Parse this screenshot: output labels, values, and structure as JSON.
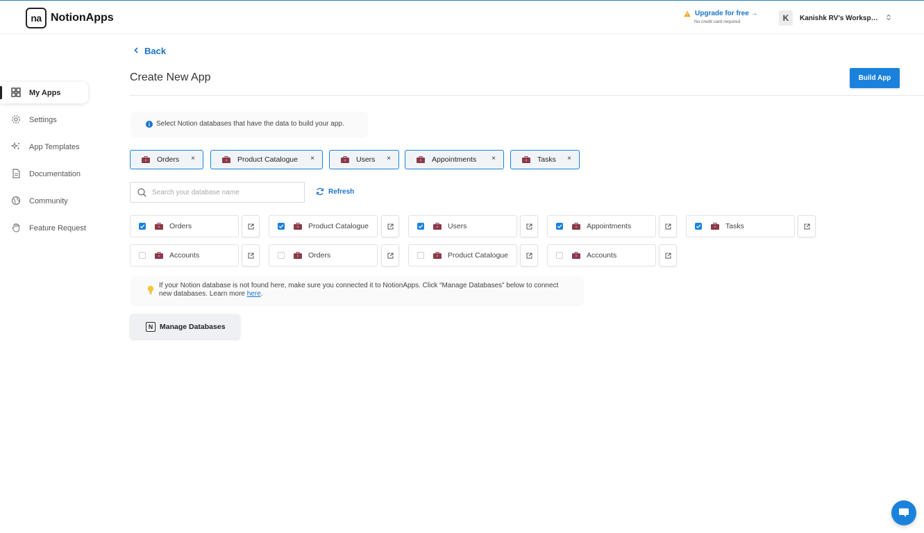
{
  "header": {
    "logo_mark": "na",
    "logo_text": "NotionApps",
    "upgrade_label": "Upgrade for free →",
    "upgrade_sub": "No credit card required",
    "workspace_initial": "K",
    "workspace_name": "Kanishk RV's Workspace"
  },
  "sidebar": {
    "items": [
      {
        "label": "My Apps",
        "icon": "grid-icon"
      },
      {
        "label": "Settings",
        "icon": "gear-icon"
      },
      {
        "label": "App Templates",
        "icon": "sparkle-icon"
      },
      {
        "label": "Documentation",
        "icon": "document-icon"
      },
      {
        "label": "Community",
        "icon": "globe-icon"
      },
      {
        "label": "Feature Request",
        "icon": "hand-icon"
      }
    ]
  },
  "main": {
    "back_label": "Back",
    "title": "Create New App",
    "build_label": "Build App",
    "info_text": "Select Notion databases that have the data to build your app.",
    "selected_chips": [
      {
        "label": "Orders"
      },
      {
        "label": "Product Catalogue"
      },
      {
        "label": "Users"
      },
      {
        "label": "Appointments"
      },
      {
        "label": "Tasks"
      }
    ],
    "chip_close": "×",
    "search_placeholder": "Search your database name",
    "refresh_label": "Refresh",
    "databases": [
      {
        "label": "Orders",
        "checked": true
      },
      {
        "label": "Product Catalogue",
        "checked": true
      },
      {
        "label": "Users",
        "checked": true
      },
      {
        "label": "Appointments",
        "checked": true
      },
      {
        "label": "Tasks",
        "checked": true
      },
      {
        "label": "Accounts",
        "checked": false
      },
      {
        "label": "Orders",
        "checked": false
      },
      {
        "label": "Product Catalogue",
        "checked": false
      },
      {
        "label": "Accounts",
        "checked": false
      }
    ],
    "note_text": "If your Notion database is not found here, make sure you connected it to NotionApps. Click “Manage Databases” below to connect new databases. Learn more ",
    "note_link": "here",
    "note_end": ".",
    "manage_icon": "N",
    "manage_label": "Manage Databases"
  },
  "colors": {
    "accent": "#1a82dc",
    "link": "#1a73c8",
    "briefcase": "#8b3a4a"
  }
}
